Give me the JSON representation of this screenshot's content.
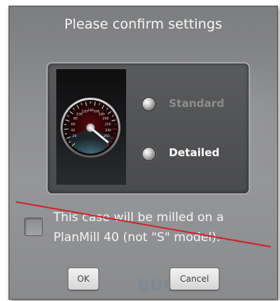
{
  "dialog": {
    "title": "Please confirm settings",
    "options": [
      {
        "label": "Standard",
        "selected": false,
        "state": "disabled",
        "label_color": "#8c8c8c"
      },
      {
        "label": "Detailed",
        "selected": true,
        "state": "active",
        "label_color": "#ffffff"
      }
    ],
    "checkbox": {
      "checked": false,
      "label_line1": "This case will be milled on a",
      "label_line2": "PlanMill 40 (not \"S\" model)."
    },
    "buttons": {
      "ok": "OK",
      "cancel": "Cancel"
    },
    "background_text": "BUG"
  },
  "gauge": {
    "icon": "speedometer-icon",
    "tick_labels": [
      "20",
      "40",
      "60",
      "80",
      "100",
      "120",
      "140",
      "160",
      "180",
      "200",
      "220",
      "240",
      "260"
    ]
  },
  "colors": {
    "annotation_line": "#d0202a",
    "gauge_accent": "#c2181f"
  }
}
